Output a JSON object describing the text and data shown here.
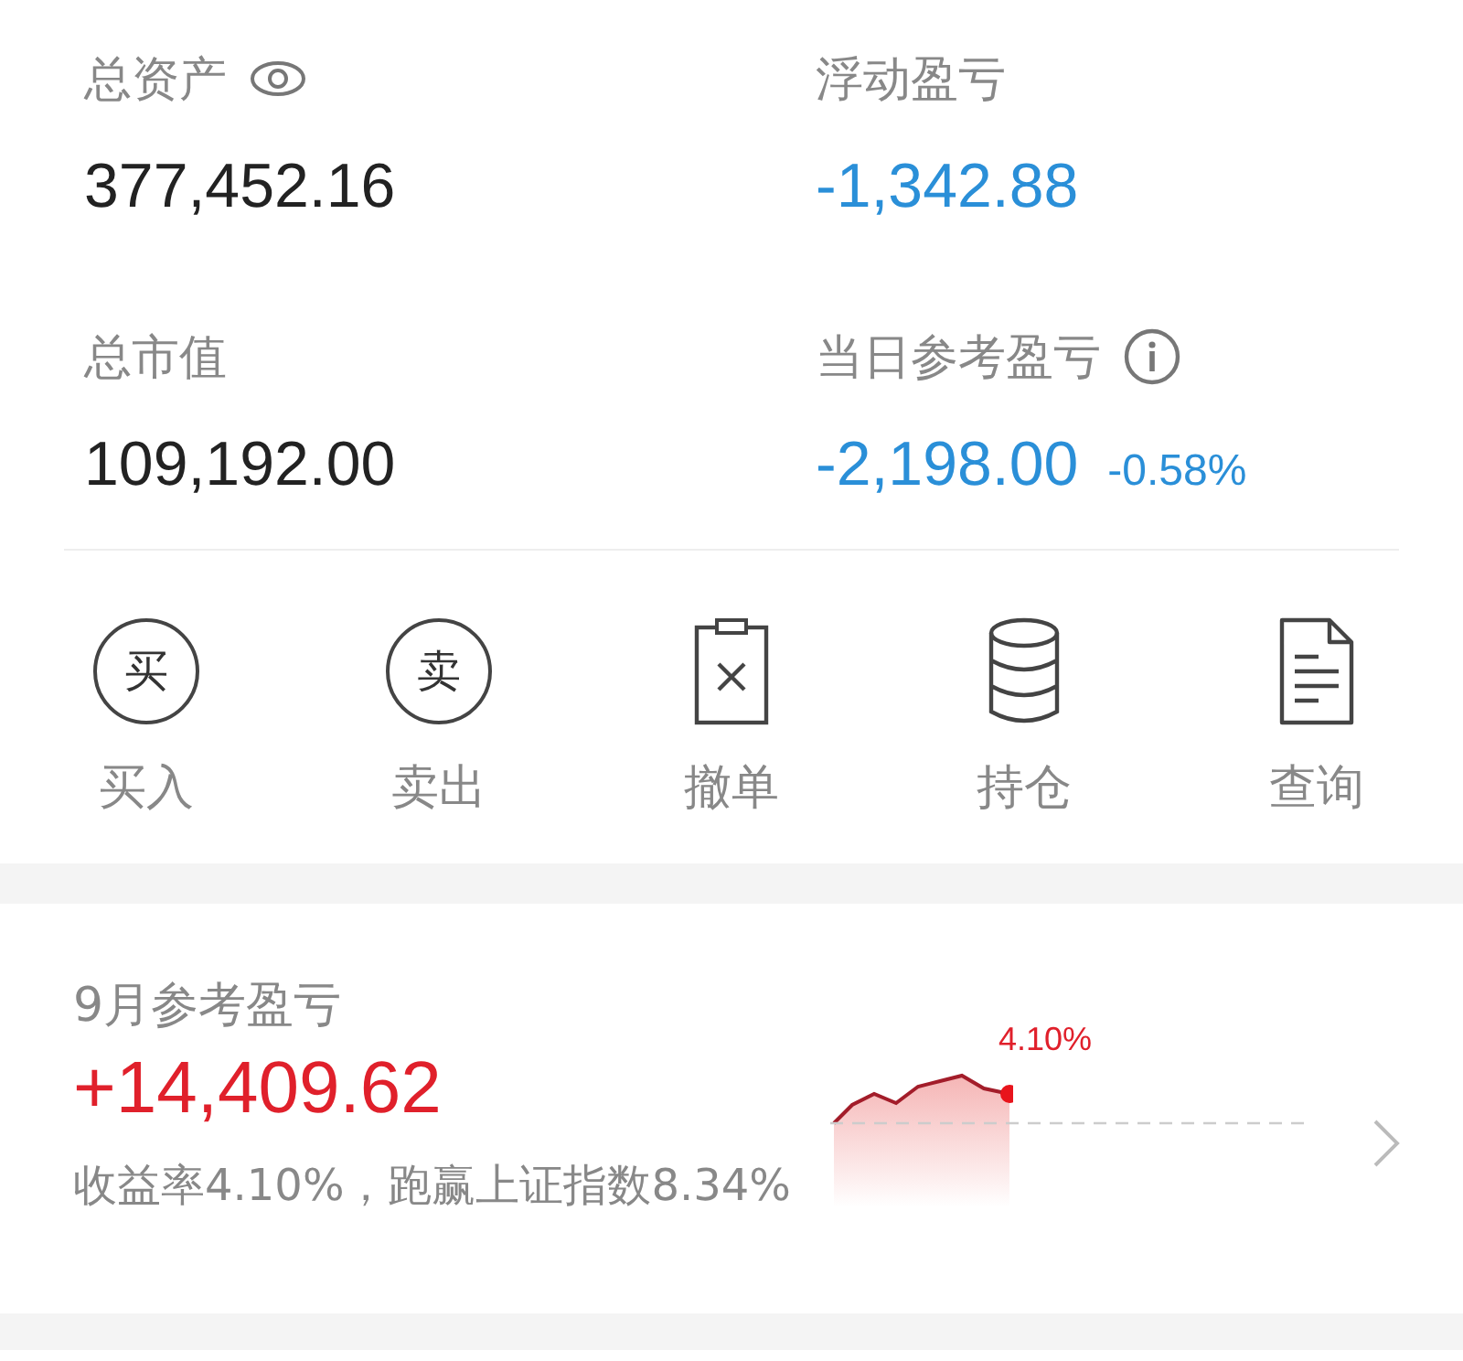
{
  "summary": [
    {
      "label": "总资产",
      "value": "377,452.16",
      "color": "#222222"
    },
    {
      "label": "浮动盈亏",
      "value": "-1,342.88",
      "color": "#2a8fd8"
    },
    {
      "label": "总市值",
      "value": "109,192.00",
      "color": "#222222"
    },
    {
      "label": "当日参考盈亏",
      "value": "-2,198.00",
      "color": "#2a8fd8",
      "percent": "-0.58%"
    }
  ],
  "actions": [
    {
      "kind": "buy",
      "glyph": "买",
      "label": "买入"
    },
    {
      "kind": "sell",
      "glyph": "卖",
      "label": "卖出"
    },
    {
      "kind": "cancel",
      "label": "撤单"
    },
    {
      "kind": "positions",
      "label": "持仓"
    },
    {
      "kind": "query",
      "label": "查询"
    }
  ],
  "monthly": {
    "label": "9月参考盈亏",
    "value": "+14,409.62",
    "sparkline_label": "4.10%",
    "note": "收益率4.10%，跑赢上证指数8.34%"
  }
}
